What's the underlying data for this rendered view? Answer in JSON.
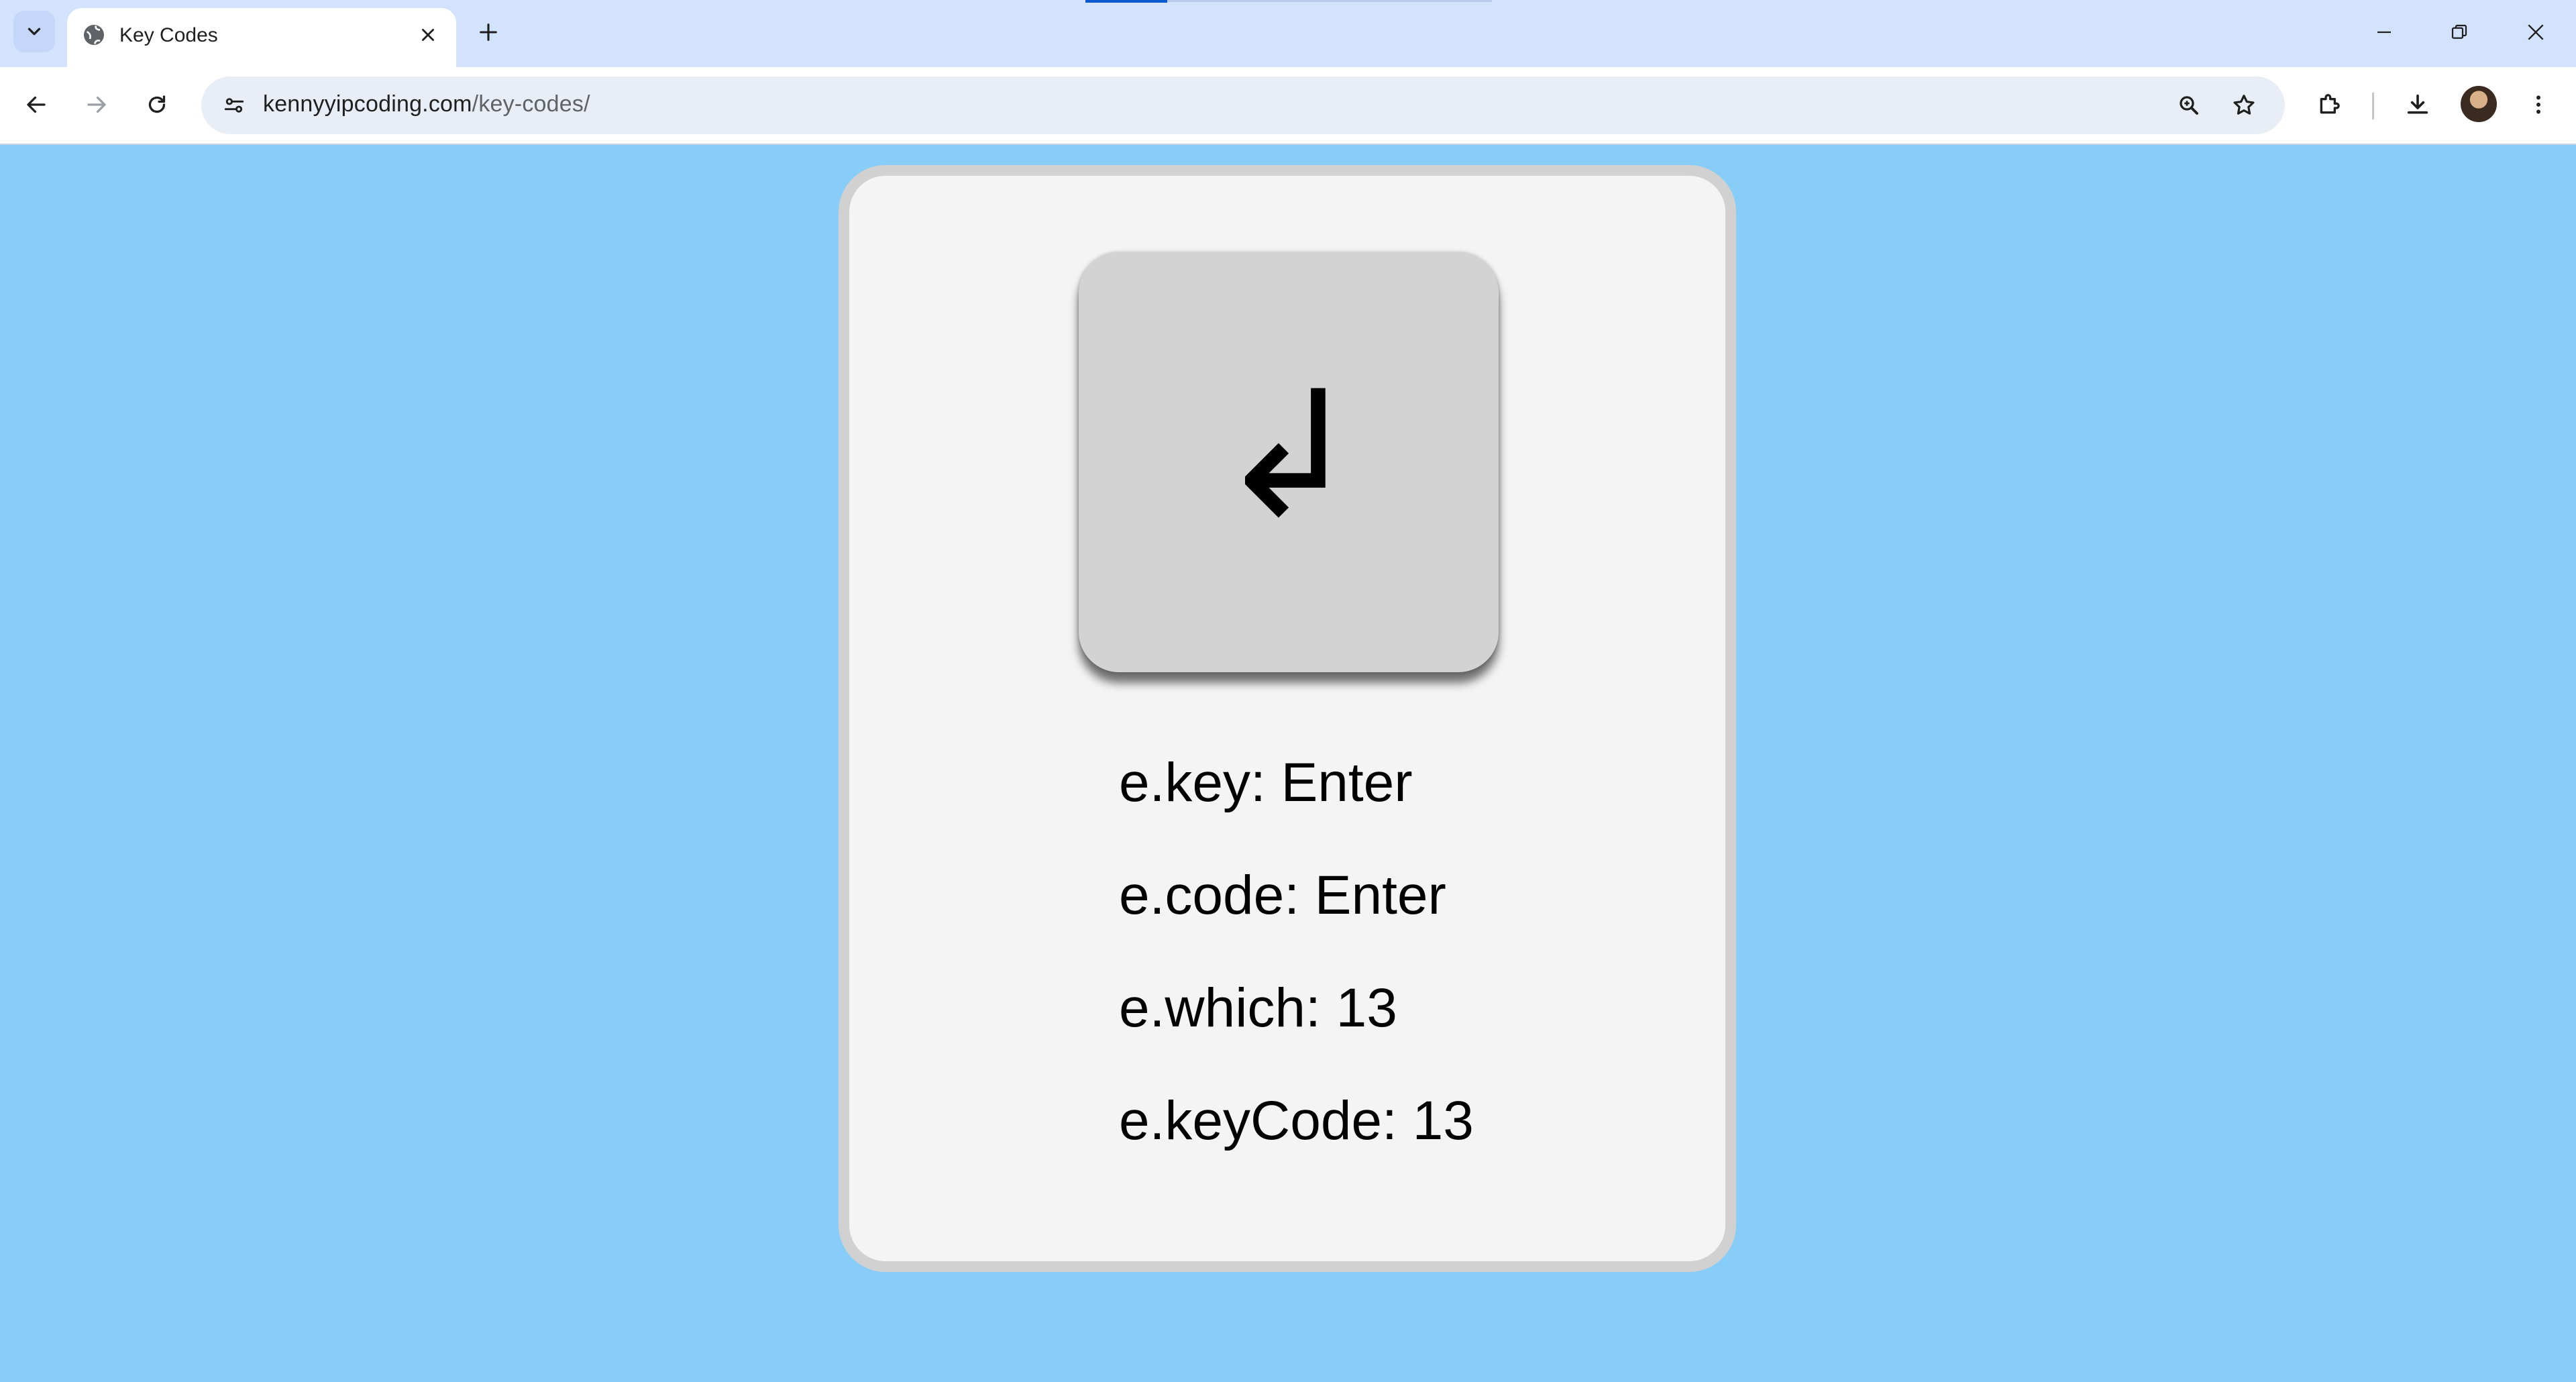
{
  "browser": {
    "tab": {
      "title": "Key Codes"
    },
    "address_bar": {
      "url_host": "kennyyipcoding.com",
      "url_path": "/key-codes/"
    }
  },
  "page": {
    "key_symbol": "↲",
    "lines": [
      {
        "label": "e.key: ",
        "value": "Enter"
      },
      {
        "label": "e.code: ",
        "value": "Enter"
      },
      {
        "label": "e.which: ",
        "value": "13"
      },
      {
        "label": "e.keyCode: ",
        "value": "13"
      }
    ]
  },
  "colors": {
    "page_background": "#87cdf8",
    "card_background": "#f4f4f4",
    "card_border": "#d1d1d1",
    "keycap": "#d3d3d3"
  },
  "icons": [
    "tab-search-icon",
    "globe-icon",
    "close-icon",
    "plus-icon",
    "minimize-icon",
    "restore-icon",
    "window-close-icon",
    "back-icon",
    "forward-icon",
    "reload-icon",
    "site-info-icon",
    "zoom-icon",
    "star-icon",
    "extensions-icon",
    "download-icon",
    "avatar",
    "menu-icon"
  ]
}
